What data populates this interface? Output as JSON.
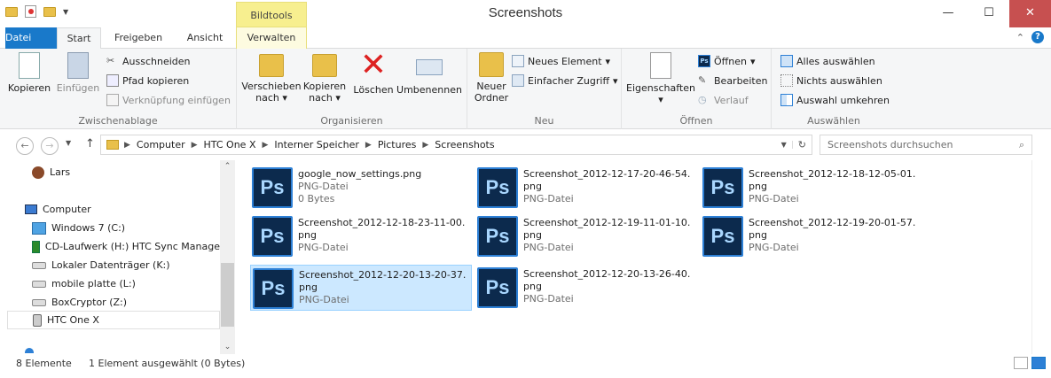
{
  "window": {
    "title": "Screenshots",
    "minimize": "—",
    "maximize": "☐",
    "close": "✕"
  },
  "context_tab_header": "Bildtools",
  "tabs": [
    {
      "label": "Datei"
    },
    {
      "label": "Start"
    },
    {
      "label": "Freigeben"
    },
    {
      "label": "Ansicht"
    },
    {
      "label": "Verwalten"
    }
  ],
  "help": "?",
  "ribbon": {
    "clipboard": {
      "label": "Zwischenablage",
      "copy": "Kopieren",
      "paste": "Einfügen",
      "cut": "Ausschneiden",
      "copy_path": "Pfad kopieren",
      "paste_shortcut": "Verknüpfung einfügen"
    },
    "organize": {
      "label": "Organisieren",
      "move_to": "Verschieben nach",
      "copy_to": "Kopieren nach",
      "delete": "Löschen",
      "rename": "Umbenennen"
    },
    "new": {
      "label": "Neu",
      "new_folder": "Neuer Ordner",
      "new_item": "Neues Element",
      "easy_access": "Einfacher Zugriff"
    },
    "open": {
      "label": "Öffnen",
      "properties": "Eigenschaften",
      "open": "Öffnen",
      "edit": "Bearbeiten",
      "history": "Verlauf"
    },
    "select": {
      "label": "Auswählen",
      "select_all": "Alles auswählen",
      "select_none": "Nichts auswählen",
      "invert": "Auswahl umkehren"
    }
  },
  "address": {
    "crumbs": [
      "Computer",
      "HTC One X",
      "Interner Speicher",
      "Pictures",
      "Screenshots"
    ],
    "search_placeholder": "Screenshots durchsuchen"
  },
  "nav": {
    "user": "Lars",
    "computer": "Computer",
    "drives": [
      "Windows 7 (C:)",
      "CD-Laufwerk (H:) HTC Sync Manage",
      "Lokaler Datenträger (K:)",
      "mobile platte (L:)",
      "BoxCryptor (Z:)",
      "HTC One X"
    ]
  },
  "files": [
    {
      "name": "google_now_settings.png",
      "type": "PNG-Datei",
      "size": "0 Bytes"
    },
    {
      "name": "Screenshot_2012-12-17-20-46-54.png",
      "type": "PNG-Datei"
    },
    {
      "name": "Screenshot_2012-12-18-12-05-01.png",
      "type": "PNG-Datei"
    },
    {
      "name": "Screenshot_2012-12-18-23-11-00.png",
      "type": "PNG-Datei"
    },
    {
      "name": "Screenshot_2012-12-19-11-01-10.png",
      "type": "PNG-Datei"
    },
    {
      "name": "Screenshot_2012-12-19-20-01-57.png",
      "type": "PNG-Datei"
    },
    {
      "name": "Screenshot_2012-12-20-13-20-37.png",
      "type": "PNG-Datei"
    },
    {
      "name": "Screenshot_2012-12-20-13-26-40.png",
      "type": "PNG-Datei"
    }
  ],
  "file_icon_label": "Ps",
  "status": {
    "count": "8 Elemente",
    "selection": "1 Element ausgewählt (0 Bytes)"
  }
}
